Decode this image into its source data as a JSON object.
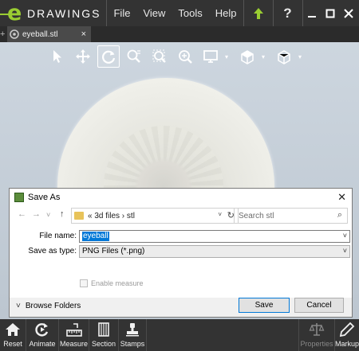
{
  "app": {
    "logo_text": "DRAWINGS"
  },
  "menu": {
    "items": [
      "File",
      "View",
      "Tools",
      "Help"
    ]
  },
  "titlebar_icons": {
    "upload": "upload-icon",
    "help": "?"
  },
  "window_controls": {
    "minimize": "—",
    "maximize": "☐",
    "close": "✕"
  },
  "tabs": {
    "add": "+",
    "active": {
      "label": "eyeball.stl",
      "close": "×"
    }
  },
  "toolbar": {
    "tools": [
      "select",
      "pan",
      "rotate",
      "zoom-to-fit",
      "zoom-to-area",
      "zoom-in-out",
      "display",
      "views",
      "standard-views"
    ],
    "active_tool": "rotate"
  },
  "dialog": {
    "title": "Save As",
    "close": "✕",
    "nav": {
      "back": "←",
      "forward": "→",
      "dropdown": "˅",
      "up": "↑"
    },
    "address": {
      "path": "«  3d files  ›  stl",
      "dropdown": "˅",
      "refresh": "↻"
    },
    "search": {
      "placeholder": "Search stl",
      "icon": "⌕"
    },
    "file_name": {
      "label": "File name:",
      "value": "eyeball",
      "dropdown": "˅"
    },
    "save_type": {
      "label": "Save as type:",
      "value": "PNG Files (*.png)",
      "dropdown": "˅"
    },
    "enable_measure": {
      "label": "Enable measure",
      "checked": false,
      "enabled": false
    },
    "browse_folders": {
      "label": "Browse Folders",
      "chevron": "˅"
    },
    "buttons": {
      "save": "Save",
      "cancel": "Cancel"
    }
  },
  "bottombar": {
    "items": [
      {
        "label": "Reset",
        "icon": "house-icon"
      },
      {
        "label": "Animate",
        "icon": "animate-icon"
      },
      {
        "label": "Measure",
        "icon": "measure-icon"
      },
      {
        "label": "Section",
        "icon": "section-icon"
      },
      {
        "label": "Stamps",
        "icon": "stamp-icon"
      },
      {
        "label": "Properties",
        "icon": "scale-icon",
        "disabled": true
      },
      {
        "label": "Markup",
        "icon": "pencil-icon"
      }
    ]
  },
  "colors": {
    "accent_green": "#9acd32",
    "chrome": "#333333",
    "viewport_bg": "#c6d0da",
    "selection_blue": "#0078d7"
  }
}
